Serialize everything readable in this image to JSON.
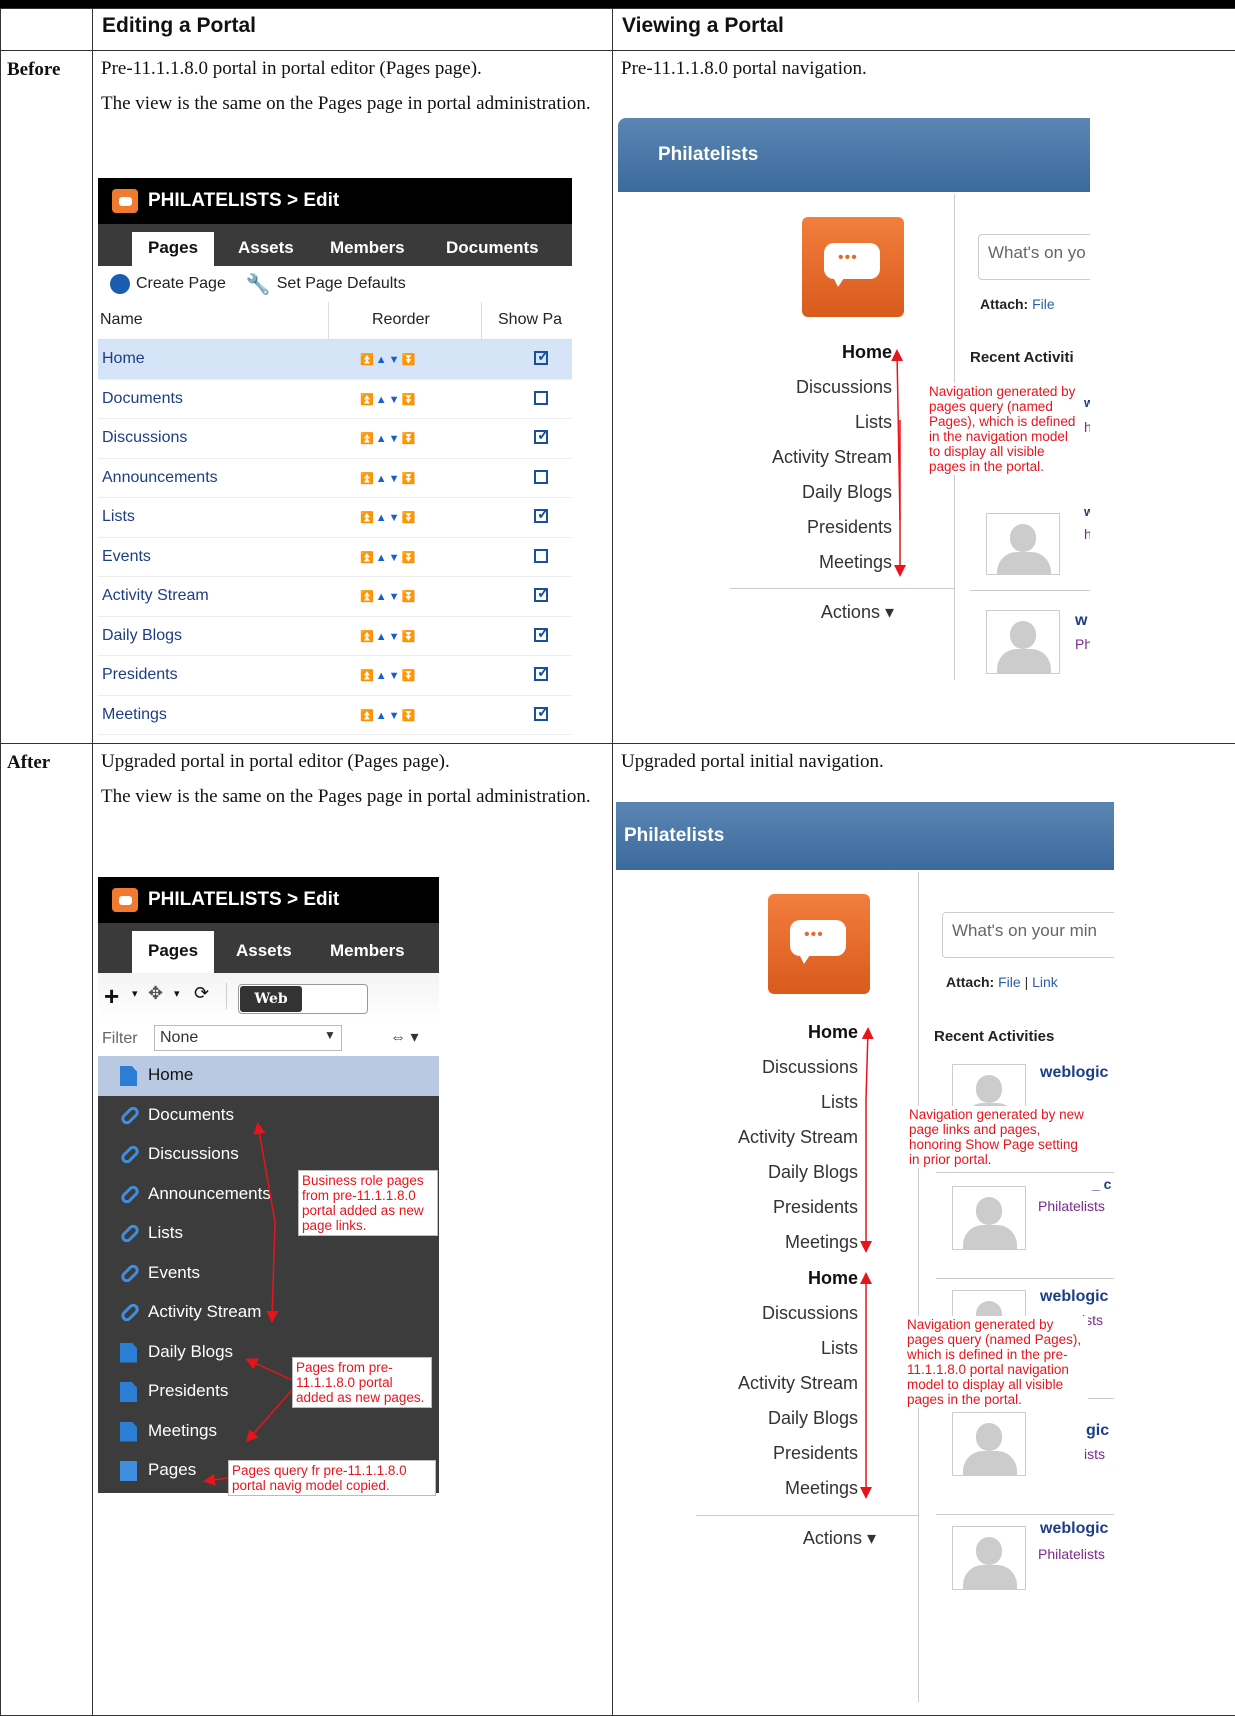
{
  "table": {
    "headers": [
      "",
      "Editing a Portal",
      "Viewing a Portal"
    ],
    "before": {
      "label": "Before",
      "edit_p1": "Pre-11.1.1.8.0 portal in portal editor (Pages page).",
      "edit_p2": "The view is the same on the Pages page in portal administration.",
      "view_p1": "Pre-11.1.1.8.0 portal navigation."
    },
    "after": {
      "label": "After",
      "edit_p1": "Upgraded portal in portal editor (Pages page).",
      "edit_p2": "The view is the same on the Pages page in portal administration.",
      "view_p1": "Upgraded portal initial navigation."
    }
  },
  "editor_before": {
    "title": "PHILATELISTS > Edit",
    "tabs": [
      "Pages",
      "Assets",
      "Members",
      "Documents"
    ],
    "toolbar": {
      "create": "Create Page",
      "defaults": "Set Page Defaults"
    },
    "columns": [
      "Name",
      "Reorder",
      "Show Pa"
    ],
    "rows": [
      {
        "name": "Home",
        "show": true
      },
      {
        "name": "Documents",
        "show": false
      },
      {
        "name": "Discussions",
        "show": true
      },
      {
        "name": "Announcements",
        "show": false
      },
      {
        "name": "Lists",
        "show": true
      },
      {
        "name": "Events",
        "show": false
      },
      {
        "name": "Activity Stream",
        "show": true
      },
      {
        "name": "Daily Blogs",
        "show": true
      },
      {
        "name": "Presidents",
        "show": true
      },
      {
        "name": "Meetings",
        "show": true
      }
    ],
    "arrows": "⏫▲▼⏬"
  },
  "editor_after": {
    "title": "PHILATELISTS > Edit",
    "tabs": [
      "Pages",
      "Assets",
      "Members"
    ],
    "toggle": "Web",
    "filter_label": "Filter",
    "filter_value": "None",
    "rows": [
      {
        "name": "Home",
        "icon": "page"
      },
      {
        "name": "Documents",
        "icon": "link"
      },
      {
        "name": "Discussions",
        "icon": "link"
      },
      {
        "name": "Announcements",
        "icon": "link"
      },
      {
        "name": "Lists",
        "icon": "link"
      },
      {
        "name": "Events",
        "icon": "link"
      },
      {
        "name": "Activity Stream",
        "icon": "link"
      },
      {
        "name": "Daily Blogs",
        "icon": "page"
      },
      {
        "name": "Presidents",
        "icon": "page"
      },
      {
        "name": "Meetings",
        "icon": "page"
      },
      {
        "name": "Pages",
        "icon": "query"
      }
    ],
    "ann_business": "Business role pages from pre-11.1.1.8.0 portal added as new page links.",
    "ann_pages": "Pages from pre-11.1.1.8.0 portal added as new pages.",
    "ann_query": "Pages query fr pre-11.1.1.8.0 portal navig model copied."
  },
  "view_before": {
    "title": "Philatelists",
    "nav": [
      "Home",
      "Discussions",
      "Lists",
      "Activity Stream",
      "Daily Blogs",
      "Presidents",
      "Meetings"
    ],
    "actions": "Actions ▾",
    "whats": "What's on yo",
    "attach_label": "Attach:",
    "attach_file": "File",
    "recent": "Recent Activiti",
    "snip1": "w",
    "snip2": "h",
    "snip3": "w",
    "snip4": "h",
    "weblogic": "w",
    "phil": "Ph",
    "annotation": "Navigation generated by pages query (named Pages), which is defined in the navigation model to display all visible pages in the portal."
  },
  "view_after": {
    "title": "Philatelists",
    "nav1": [
      "Home",
      "Discussions",
      "Lists",
      "Activity Stream",
      "Daily Blogs",
      "Presidents",
      "Meetings"
    ],
    "nav2": [
      "Home",
      "Discussions",
      "Lists",
      "Activity Stream",
      "Daily Blogs",
      "Presidents",
      "Meetings"
    ],
    "actions": "Actions ▾",
    "whats": "What's on your min",
    "attach_label": "Attach:",
    "attach_file": "File",
    "attach_link": "Link",
    "recent": "Recent Activities",
    "weblogic": "weblogic",
    "phil_partial": "Philatelists",
    "phil": "Philatelists",
    "c_snip": "_ c",
    "ists": "ists",
    "gic": "gic",
    "ann1": "Navigation generated by new page links and pages, honoring Show Page setting in prior portal.",
    "ann2": "Navigation generated by pages query (named Pages), which is defined in the pre-11.1.1.8.0 portal navigation model to display all visible pages in the portal."
  }
}
